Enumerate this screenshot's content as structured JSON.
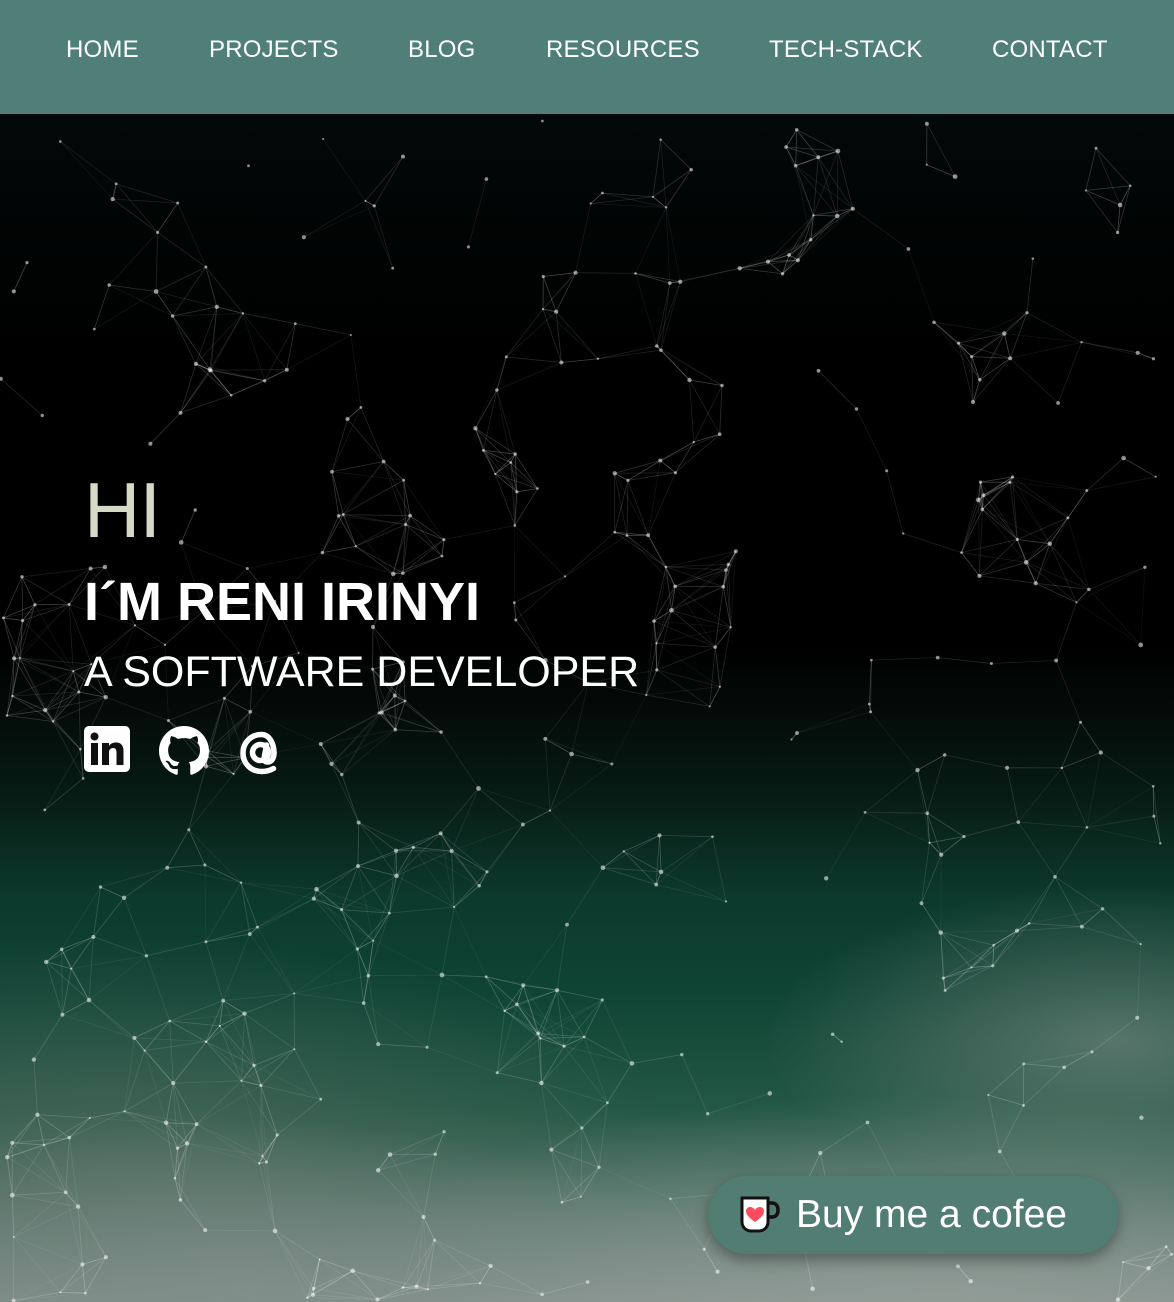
{
  "nav": {
    "items": [
      {
        "label": "HOME"
      },
      {
        "label": "PROJECTS"
      },
      {
        "label": "BLOG"
      },
      {
        "label": "RESOURCES"
      },
      {
        "label": "TECH-STACK"
      },
      {
        "label": "CONTACT"
      }
    ]
  },
  "hero": {
    "greeting": "HI",
    "name": "I´M RENI IRINYI",
    "role": "A SOFTWARE DEVELOPER",
    "social": [
      {
        "icon": "linkedin-icon"
      },
      {
        "icon": "github-icon"
      },
      {
        "icon": "at-sign-icon"
      }
    ]
  },
  "coffee_button": {
    "label": "Buy me a cofee",
    "icon": "coffee-cup-heart-icon"
  },
  "colors": {
    "navbar": "#4f7f78",
    "greeting": "#d4dac6",
    "coffee_button": "#527d73"
  }
}
